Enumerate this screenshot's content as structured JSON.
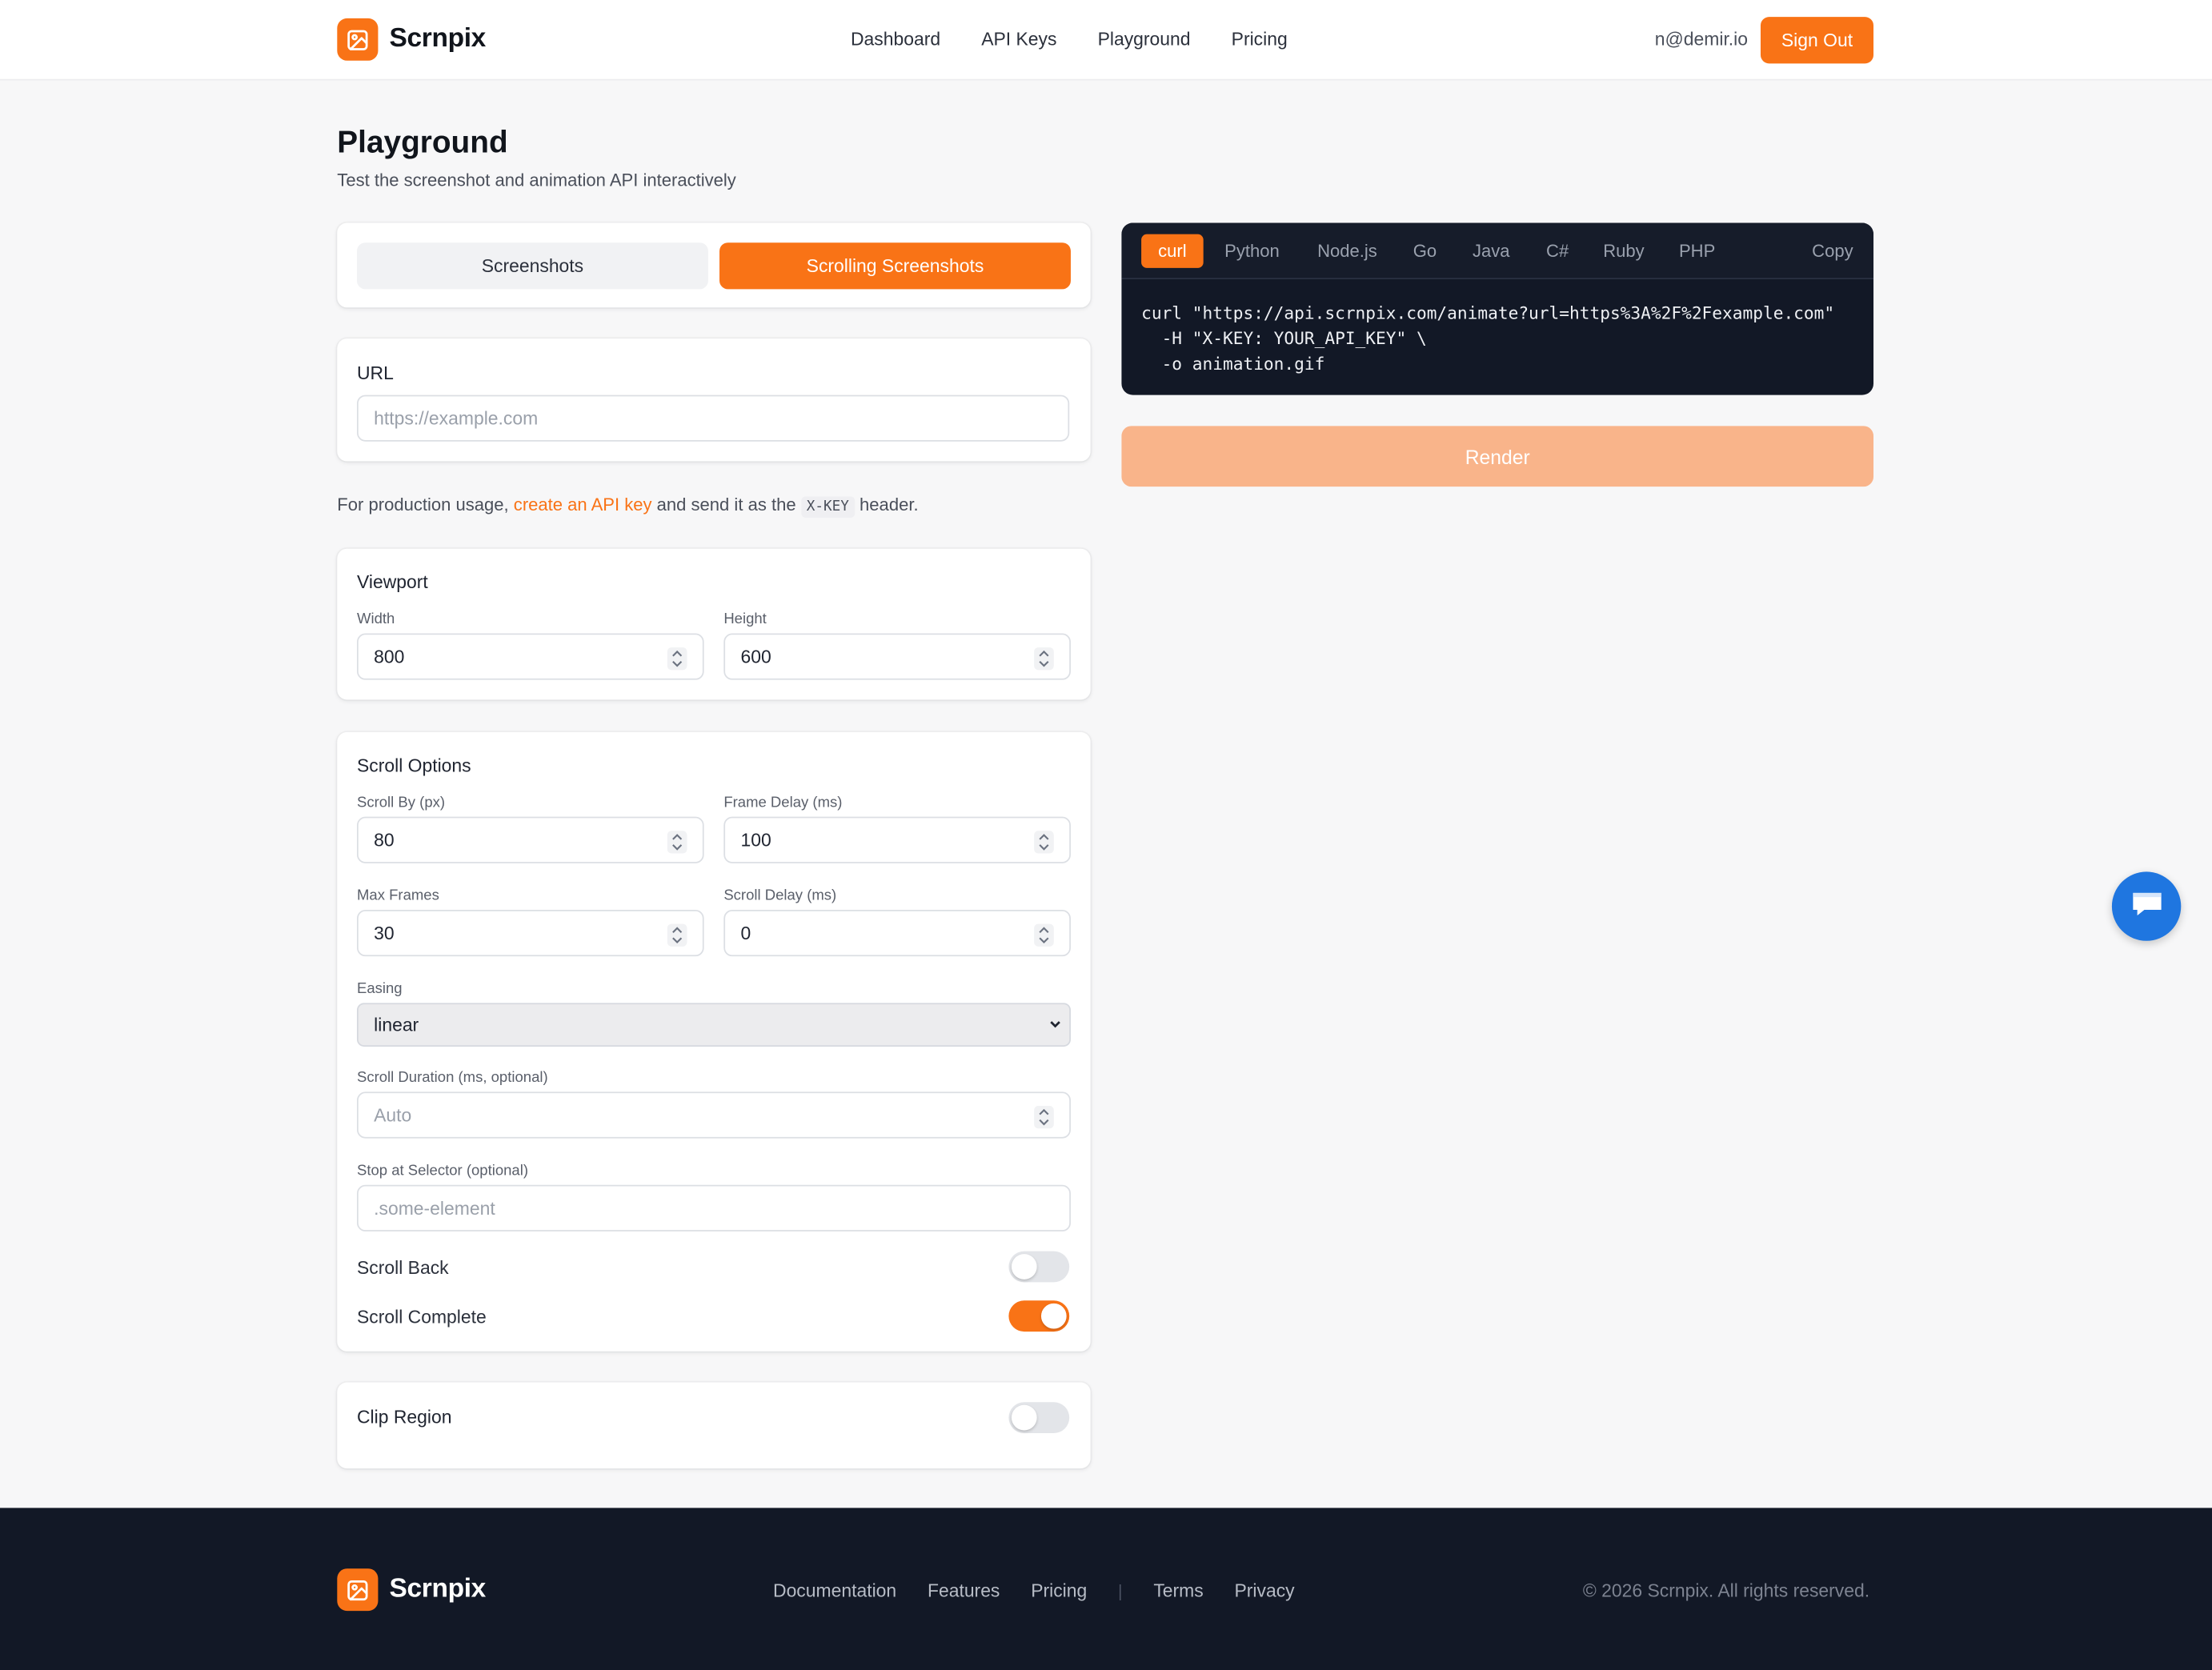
{
  "brand": {
    "name": "Scrnpix",
    "accent": "#f97316"
  },
  "nav": {
    "items": [
      "Dashboard",
      "API Keys",
      "Playground",
      "Pricing"
    ]
  },
  "user": {
    "email": "n@demir.io",
    "signout": "Sign Out"
  },
  "page": {
    "title": "Playground",
    "subtitle": "Test the screenshot and animation API interactively"
  },
  "mode": {
    "tabs": [
      "Screenshots",
      "Scrolling Screenshots"
    ],
    "active": "Scrolling Screenshots"
  },
  "url": {
    "label": "URL",
    "placeholder": "https://example.com"
  },
  "note": {
    "pre": "For production usage, ",
    "link": "create an API key",
    "mid": " and send it as the ",
    "code": "X-KEY",
    "post": " header."
  },
  "viewport": {
    "title": "Viewport",
    "width_label": "Width",
    "width": "800",
    "height_label": "Height",
    "height": "600"
  },
  "scroll": {
    "title": "Scroll Options",
    "scroll_by_label": "Scroll By (px)",
    "scroll_by": "80",
    "frame_delay_label": "Frame Delay (ms)",
    "frame_delay": "100",
    "max_frames_label": "Max Frames",
    "max_frames": "30",
    "scroll_delay_label": "Scroll Delay (ms)",
    "scroll_delay": "0",
    "easing_label": "Easing",
    "easing": "linear",
    "duration_label": "Scroll Duration (ms, optional)",
    "duration_placeholder": "Auto",
    "selector_label": "Stop at Selector (optional)",
    "selector_placeholder": ".some-element",
    "scroll_back_label": "Scroll Back",
    "scroll_back": false,
    "scroll_complete_label": "Scroll Complete",
    "scroll_complete": true
  },
  "clip": {
    "title": "Clip Region",
    "enabled": false
  },
  "code": {
    "tabs": [
      "curl",
      "Python",
      "Node.js",
      "Go",
      "Java",
      "C#",
      "Ruby",
      "PHP"
    ],
    "active": "curl",
    "copy": "Copy",
    "lines": [
      "curl \"https://api.scrnpix.com/animate?url=https%3A%2F%2Fexample.com\"",
      "  -H \"X-KEY: YOUR_API_KEY\" \\",
      "  -o animation.gif"
    ]
  },
  "render": {
    "label": "Render"
  },
  "footer": {
    "links": [
      "Documentation",
      "Features",
      "Pricing"
    ],
    "legal": [
      "Terms",
      "Privacy"
    ],
    "separator": "|",
    "copyright": "© 2026 Scrnpix. All rights reserved."
  }
}
